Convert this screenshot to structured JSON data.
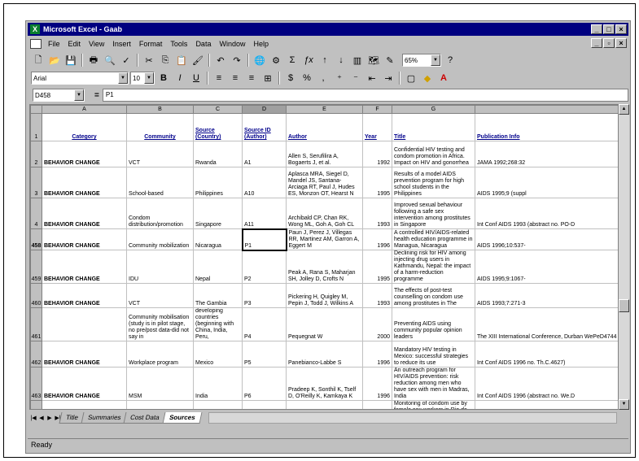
{
  "window": {
    "title": "Microsoft Excel - Gaab"
  },
  "menu": [
    "File",
    "Edit",
    "View",
    "Insert",
    "Format",
    "Tools",
    "Data",
    "Window",
    "Help"
  ],
  "toolbar": {
    "font_name": "Arial",
    "font_size": "10",
    "zoom": "65%"
  },
  "formula_bar": {
    "cell_ref": "D458",
    "content": "P1"
  },
  "columns": [
    "A",
    "B",
    "C",
    "D",
    "E",
    "F",
    "G",
    ""
  ],
  "header_row": {
    "row": "1",
    "cells": [
      "Category",
      "Community",
      "Source (Country)",
      "Source ID (Author)",
      "Author",
      "Year",
      "Title",
      "Publication Info"
    ]
  },
  "rows": [
    {
      "row": "2",
      "cells": [
        "BEHAVIOR CHANGE",
        "VCT",
        "Rwanda",
        "A1",
        "Allen S, Serufilira A, Bogaerts J, et al.",
        "1992",
        "Confidential HIV testing and condom promotion in Africa. Impact on HIV and gonorrhea",
        "JAMA 1992;268:32"
      ]
    },
    {
      "row": "3",
      "cells": [
        "BEHAVIOR CHANGE",
        "School-based",
        "Philippines",
        "A10",
        "Aplasca MRA, Siegel D, Mandel JS, Santana-Arciaga RT, Paul J, Hudes ES, Monzon OT, Hearst N",
        "1995",
        "Results of a model AIDS prevention program for high school students in the Philippines",
        "AIDS 1995;9 (suppl"
      ]
    },
    {
      "row": "4",
      "cells": [
        "BEHAVIOR CHANGE",
        "Condom distribution/promotion",
        "Singapore",
        "A11",
        "Archibald CP, Chan RK, Wong ML, Goh A, Goh CL",
        "1993",
        "Improved sexual behaviour following a safe sex intervention among prostitutes in Singapore",
        "Int Conf AIDS 1993 (abstract no. PO-D"
      ]
    },
    {
      "row": "458",
      "cells": [
        "BEHAVIOR CHANGE",
        "Community mobilization",
        "Nicaragua",
        "P1",
        "Paun J, Perez J, Villegas RR, Martinez AM, Garron A, Eggert M",
        "1996",
        "A controlled HIV/AIDS-related health education programme in Managua, Nicaragua",
        "AIDS 1996;10:537-"
      ]
    },
    {
      "row": "459",
      "cells": [
        "BEHAVIOR CHANGE",
        "IDU",
        "Nepal",
        "P2",
        "Peak A, Rana S, Maharjan SH, Jolley D, Crofts N",
        "1995",
        "Declining risk for HIV among injecting drug users in Kathmandu, Nepal: the impact of a harm-reduction programme",
        "AIDS 1995;9:1067-"
      ]
    },
    {
      "row": "460",
      "cells": [
        "BEHAVIOR CHANGE",
        "VCT",
        "The Gambia",
        "P3",
        "Pickering H, Quigley M, Pepin J, Todd J, Wilkins A",
        "1993",
        "The effects of post-test counselling on condom use among prostitutes in The",
        "AIDS 1993;7:271-3"
      ]
    },
    {
      "row": "461",
      "cells": [
        "",
        "Community mobilisation (study is in pilot stage, no pre/post data-did not say in",
        "developing countries (beginning with China, India, Peru,",
        "P4",
        "Pequegnat W",
        "2000",
        "Preventing AIDS using community popular opinion leaders",
        "The XIII International Conference, Durban WePeD4744"
      ]
    },
    {
      "row": "462",
      "cells": [
        "BEHAVIOR CHANGE",
        "Workplace program",
        "Mexico",
        "P5",
        "Panebianco-Labbe S",
        "1996",
        "Mandatory HIV testing in Mexico: successful strategies to reduce its use",
        "Int Conf AIDS 1996 no. Th.C.4627)"
      ]
    },
    {
      "row": "463",
      "cells": [
        "BEHAVIOR CHANGE",
        "MSM",
        "India",
        "P6",
        "Pradeep K, Sonthil K, Tself D, O'Reilly K, Kamkaya K",
        "1996",
        "An outreach program for HIV/AIDS prevention: risk reduction among men who have sex with men in Madras, India",
        "Int Conf AIDS 1996 (abstract no. We.D"
      ]
    },
    {
      "row": "",
      "cells": [
        "",
        "",
        "",
        "",
        "",
        "",
        "Monitoring of condom use by female sex workers in Rio de",
        ""
      ]
    }
  ],
  "sheet_tabs": [
    "Title",
    "Summaries",
    "Cost Data",
    "Sources"
  ],
  "active_tab": "Sources",
  "status": "Ready"
}
